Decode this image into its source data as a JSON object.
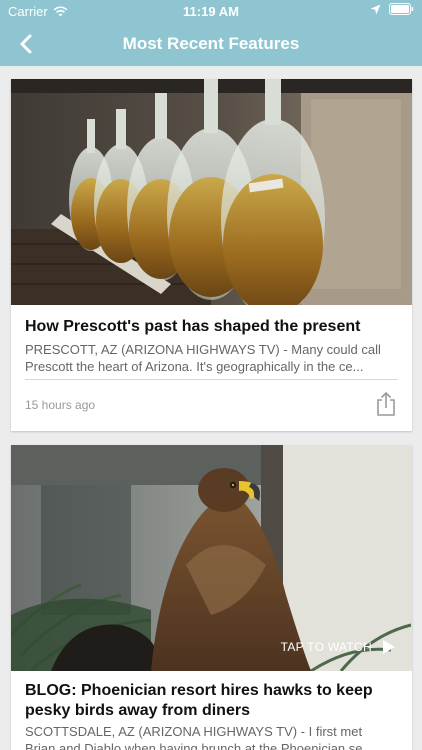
{
  "status_bar": {
    "carrier": "Carrier",
    "time": "11:19 AM"
  },
  "nav": {
    "title": "Most Recent Features",
    "back_icon": "chevron-left-icon"
  },
  "colors": {
    "header": "#8ec5d1",
    "background": "#ececec",
    "card": "#ffffff"
  },
  "features": [
    {
      "headline": "How Prescott's past has shaped the present",
      "summary": "PRESCOTT, AZ (ARIZONA HIGHWAYS TV) - Many could call Prescott the heart of Arizona. It's geographically in the ce...",
      "summary_line1": "PRESCOTT, AZ (ARIZONA HIGHWAYS TV) - Many could call",
      "summary_line2": "Prescott the heart of Arizona. It's geographically in the ce...",
      "timestamp": "15 hours ago",
      "share_icon": "share-icon"
    },
    {
      "headline": "BLOG: Phoenician resort hires hawks to keep pesky birds away from diners",
      "headline_line1": "BLOG: Phoenician resort hires hawks to keep",
      "headline_line2": "pesky birds away from diners",
      "summary_line1": "SCOTTSDALE, AZ (ARIZONA HIGHWAYS TV) - I first met",
      "summary_line2": "Brian and Diablo when having brunch at the Phoenician se...",
      "tap_label": "TAP TO WATCH",
      "play_icon": "play-icon"
    }
  ]
}
